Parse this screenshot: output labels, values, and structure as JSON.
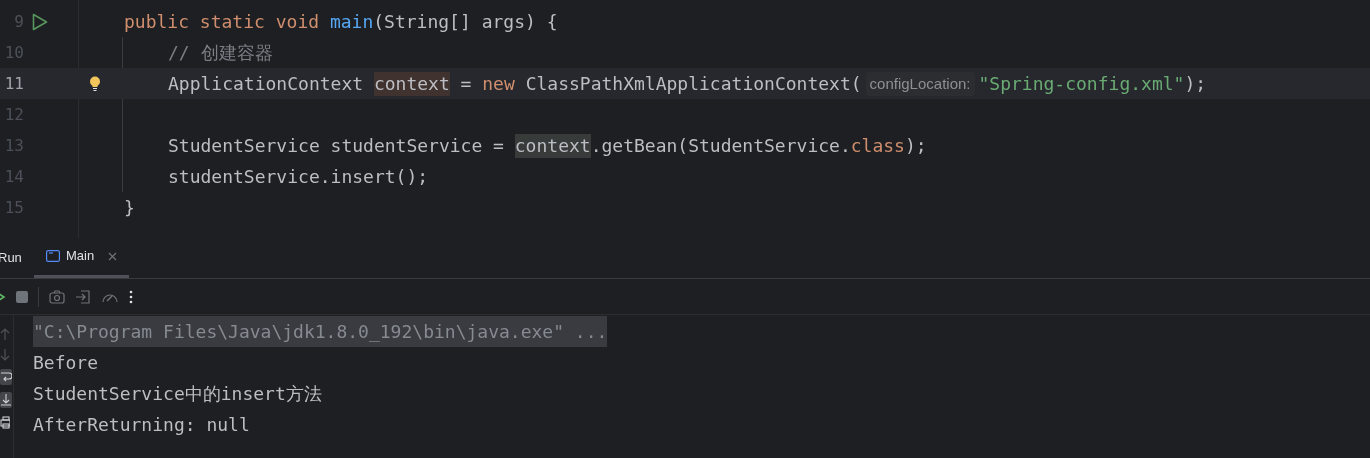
{
  "editor": {
    "lines": [
      {
        "number": "9",
        "current": false,
        "run_marker": true,
        "kind": "signature",
        "tokens": [
          {
            "text": "public static void ",
            "kind": "keyword"
          },
          {
            "text": "main",
            "kind": "function"
          },
          {
            "text": "(String[] args) {",
            "kind": "plain"
          }
        ]
      },
      {
        "number": "10",
        "current": false,
        "kind": "statement",
        "tokens": [
          {
            "text": "// 创建容器",
            "kind": "comment"
          }
        ]
      },
      {
        "number": "11",
        "current": true,
        "intention_bulb": true,
        "kind": "statement",
        "tokens": [
          {
            "text": "ApplicationContext ",
            "kind": "plain"
          },
          {
            "text": "context",
            "kind": "write_highlight"
          },
          {
            "text": " = ",
            "kind": "plain"
          },
          {
            "text": "new ",
            "kind": "keyword"
          },
          {
            "text": "ClassPathXmlApplicationContext(",
            "kind": "plain"
          },
          {
            "text": "configLocation:",
            "kind": "hint"
          },
          {
            "text": "\"Spring-config.xml\"",
            "kind": "string"
          },
          {
            "text": ");",
            "kind": "plain"
          }
        ]
      },
      {
        "number": "12",
        "current": false,
        "kind": "blank"
      },
      {
        "number": "13",
        "current": false,
        "kind": "statement",
        "tokens": [
          {
            "text": "StudentService studentService = ",
            "kind": "plain"
          },
          {
            "text": "context",
            "kind": "read_highlight"
          },
          {
            "text": ".getBean(StudentService.",
            "kind": "plain"
          },
          {
            "text": "class",
            "kind": "keyword"
          },
          {
            "text": ");",
            "kind": "plain"
          }
        ]
      },
      {
        "number": "14",
        "current": false,
        "kind": "statement",
        "tokens": [
          {
            "text": "studentService.insert();",
            "kind": "plain"
          }
        ]
      },
      {
        "number": "15",
        "current": false,
        "kind": "closing",
        "tokens": [
          {
            "text": "}",
            "kind": "plain"
          }
        ]
      }
    ]
  },
  "run_panel": {
    "title": "Run",
    "tabs": [
      {
        "label": "Main",
        "selected": true
      }
    ],
    "console": [
      {
        "text": "\"C:\\Program Files\\Java\\jdk1.8.0_192\\bin\\java.exe\" ...",
        "kind": "command"
      },
      {
        "text": "Before",
        "kind": "output"
      },
      {
        "text": "StudentService中的insert方法",
        "kind": "output"
      },
      {
        "text": "AfterReturning: null",
        "kind": "output"
      }
    ]
  }
}
